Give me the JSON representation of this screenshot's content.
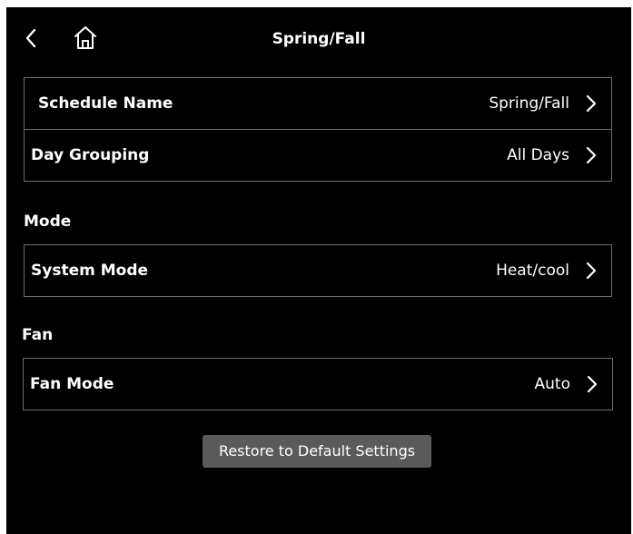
{
  "header": {
    "title": "Spring/Fall",
    "back_icon": "back-arrow-icon",
    "home_icon": "home-icon"
  },
  "schedule_group": [
    {
      "label": "Schedule Name",
      "value": "Spring/Fall"
    },
    {
      "label": "Day Grouping",
      "value": "All Days"
    }
  ],
  "mode": {
    "heading": "Mode",
    "label": "System Mode",
    "value": "Heat/cool"
  },
  "fan": {
    "heading": "Fan",
    "label": "Fan Mode",
    "value": "Auto"
  },
  "restore_label": "Restore to Default Settings",
  "colors": {
    "background": "#000000",
    "border": "#6e6e6e",
    "button": "#5a5a5a"
  }
}
